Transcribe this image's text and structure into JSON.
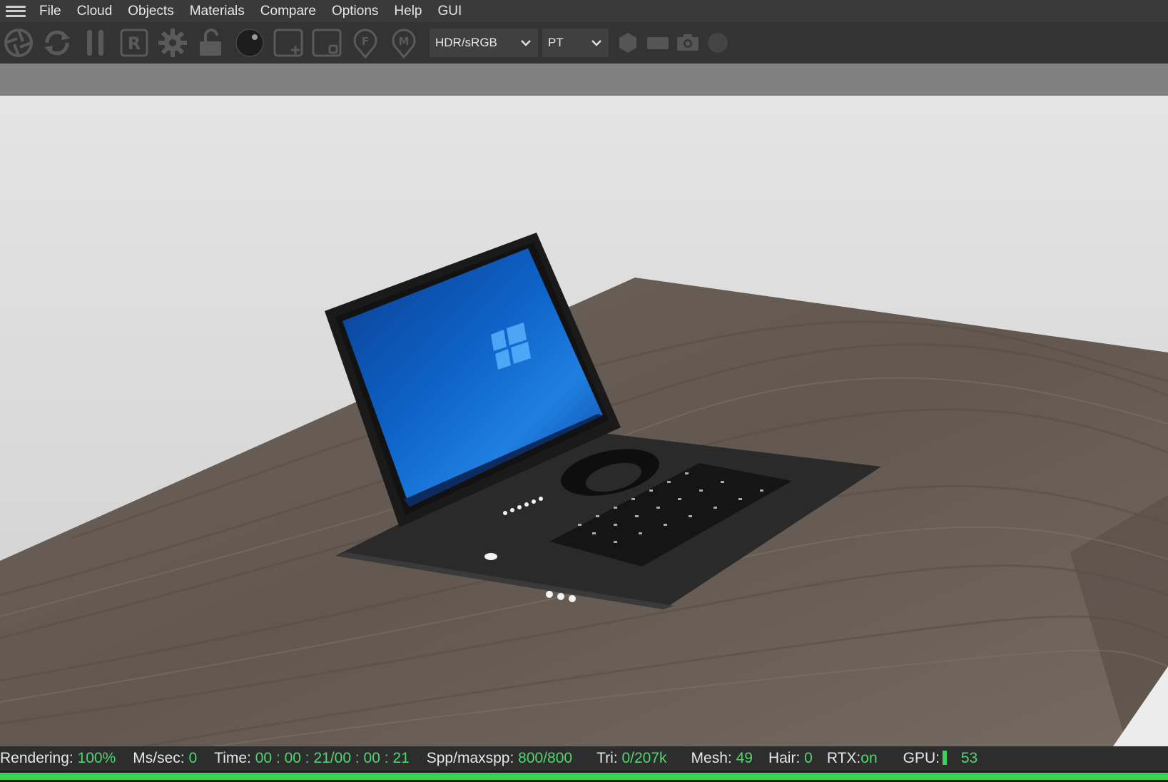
{
  "menu": {
    "hamburger_icon": "hamburger-menu-icon",
    "items": [
      "File",
      "Cloud",
      "Objects",
      "Materials",
      "Compare",
      "Options",
      "Help",
      "GUI"
    ]
  },
  "toolbar": {
    "icons": [
      "aperture-icon",
      "refresh-icon",
      "pause-icon",
      "render-r-icon",
      "gear-icon",
      "unlock-icon",
      "sphere-icon",
      "add-region-icon",
      "region-icon",
      "focus-pin-icon",
      "material-pin-icon"
    ],
    "colorspace": {
      "selected": "HDR/sRGB"
    },
    "kernel": {
      "selected": "PT"
    },
    "trailing_icons": [
      "hexagon-icon",
      "film-icon",
      "camera-icon",
      "circle-icon"
    ]
  },
  "scene": {
    "description_icon": "laptop-render-image"
  },
  "status": {
    "rendering_label": "Rendering:",
    "rendering_value": "100%",
    "mssec_label": "Ms/sec:",
    "mssec_value": "0",
    "time_label": "Time:",
    "time_value": "00 : 00 : 21/00 : 00 : 21",
    "spp_label": "Spp/maxspp:",
    "spp_value": "800/800",
    "tri_label": "Tri:",
    "tri_value": "0/207k",
    "mesh_label": "Mesh:",
    "mesh_value": "49",
    "hair_label": "Hair:",
    "hair_value": "0",
    "rtx_label": "RTX:",
    "rtx_value": "on",
    "gpu_label": "GPU:",
    "gpu_value": "53"
  },
  "progress": {
    "fraction": 1.0
  },
  "colors": {
    "accent_green": "#4fd66f",
    "progress_green": "#38d150"
  }
}
